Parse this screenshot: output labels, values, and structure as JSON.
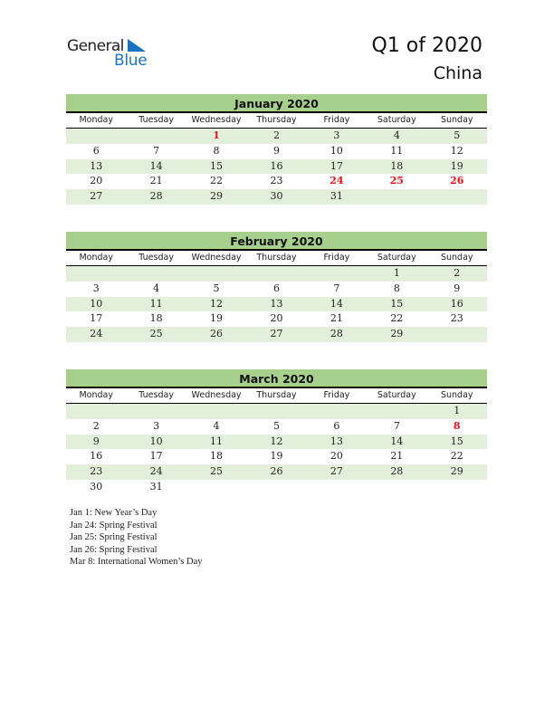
{
  "logo": {
    "word1": "General",
    "word2": "Blue",
    "icon": "flag-triangle-icon"
  },
  "header": {
    "title": "Q1 of 2020",
    "subtitle": "China"
  },
  "colors": {
    "header_band": "#a8d08d",
    "row_shade": "#e2efda",
    "holiday": "#e8141a",
    "logo_blue": "#1a73c0"
  },
  "weekdays": [
    "Monday",
    "Tuesday",
    "Wednesday",
    "Thursday",
    "Friday",
    "Saturday",
    "Sunday"
  ],
  "months": [
    {
      "name": "January 2020",
      "weeks": [
        [
          "",
          "",
          "1",
          "2",
          "3",
          "4",
          "5"
        ],
        [
          "6",
          "7",
          "8",
          "9",
          "10",
          "11",
          "12"
        ],
        [
          "13",
          "14",
          "15",
          "16",
          "17",
          "18",
          "19"
        ],
        [
          "20",
          "21",
          "22",
          "23",
          "24",
          "25",
          "26"
        ],
        [
          "27",
          "28",
          "29",
          "30",
          "31",
          "",
          ""
        ]
      ],
      "holidays": [
        "1",
        "24",
        "25",
        "26"
      ]
    },
    {
      "name": "February 2020",
      "weeks": [
        [
          "",
          "",
          "",
          "",
          "",
          "1",
          "2"
        ],
        [
          "3",
          "4",
          "5",
          "6",
          "7",
          "8",
          "9"
        ],
        [
          "10",
          "11",
          "12",
          "13",
          "14",
          "15",
          "16"
        ],
        [
          "17",
          "18",
          "19",
          "20",
          "21",
          "22",
          "23"
        ],
        [
          "24",
          "25",
          "26",
          "27",
          "28",
          "29",
          ""
        ]
      ],
      "holidays": []
    },
    {
      "name": "March 2020",
      "weeks": [
        [
          "",
          "",
          "",
          "",
          "",
          "",
          "1"
        ],
        [
          "2",
          "3",
          "4",
          "5",
          "6",
          "7",
          "8"
        ],
        [
          "9",
          "10",
          "11",
          "12",
          "13",
          "14",
          "15"
        ],
        [
          "16",
          "17",
          "18",
          "19",
          "20",
          "21",
          "22"
        ],
        [
          "23",
          "24",
          "25",
          "26",
          "27",
          "28",
          "29"
        ],
        [
          "30",
          "31",
          "",
          "",
          "",
          "",
          ""
        ]
      ],
      "holidays": [
        "8"
      ]
    }
  ],
  "notes": [
    "Jan 1: New Year’s Day",
    "Jan 24: Spring Festival",
    "Jan 25: Spring Festival",
    "Jan 26: Spring Festival",
    "Mar 8: International Women’s Day"
  ]
}
